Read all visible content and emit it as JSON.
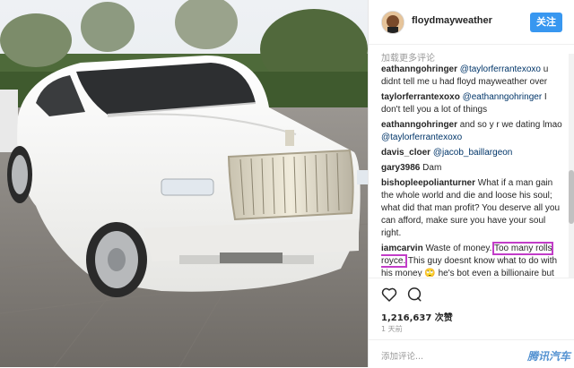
{
  "post": {
    "username": "floydmayweather",
    "follow_label": "关注",
    "load_more": "加载更多评论",
    "likes": "1,216,637 次赞",
    "time_ago": "1 天前",
    "add_comment_placeholder": "添加评论..."
  },
  "comments": [
    {
      "user": "eathanngohringer",
      "mention": "@taylorferrantexoxo",
      "text": " u didnt tell me u had floyd mayweather over"
    },
    {
      "user": "taylorferrantexoxo",
      "mention": "@eathanngohringer",
      "text": " I don't tell you a lot of things"
    },
    {
      "user": "eathanngohringer",
      "mention": "",
      "text": "and so y r we dating lmao ",
      "mention_after": "@taylorferrantexoxo"
    },
    {
      "user": "davis_cloer",
      "mention": "@jacob_baillargeon",
      "text": ""
    },
    {
      "user": "gary3986",
      "mention": "",
      "text": "Dam"
    },
    {
      "user": "bishopleepolianturner",
      "mention": "",
      "text": "What if a man gain the whole world and die and loose his soul; what did that man profit? You deserve all you can afford, make sure you have your soul right."
    }
  ],
  "highlighted_comment": {
    "user": "iamcarvin",
    "before": "Waste of money. ",
    "highlight_1": "Too many rolls",
    "highlight_2": "royce.",
    "after": " This guy doesnt know what to do with his money 🙄 he's bot even a billionaire but he shows off too much tsk tsk"
  },
  "icons": {
    "like": "heart-outline-icon",
    "comment": "comment-bubble-icon"
  },
  "watermark": "腾讯汽车",
  "colors": {
    "follow_button": "#3897f0",
    "highlight_box": "#c23dc8",
    "car": "#f4f4f2"
  }
}
